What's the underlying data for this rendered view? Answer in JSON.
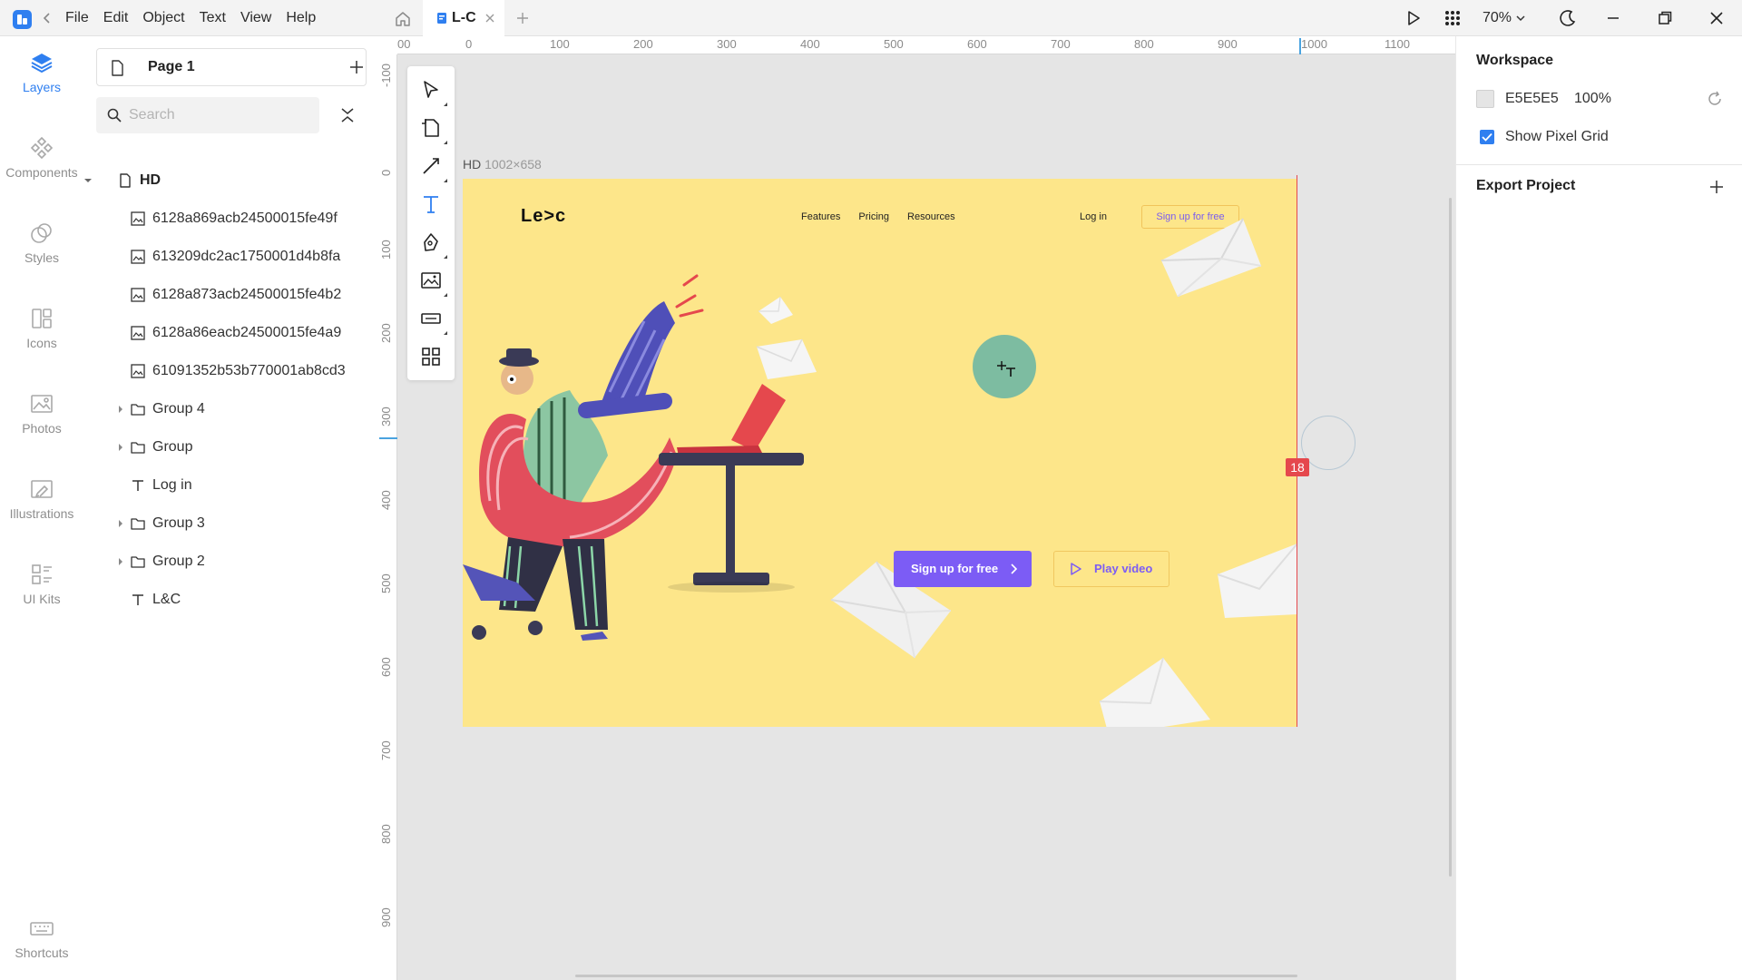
{
  "titlebar": {
    "menu": [
      "File",
      "Edit",
      "Object",
      "Text",
      "View",
      "Help"
    ],
    "tab_label": "L-C",
    "zoom": "70%"
  },
  "rail": {
    "items": [
      {
        "label": "Layers",
        "icon": "layers-icon",
        "active": true
      },
      {
        "label": "Components",
        "icon": "components-icon"
      },
      {
        "label": "Styles",
        "icon": "styles-icon"
      },
      {
        "label": "Icons",
        "icon": "icons-icon"
      },
      {
        "label": "Photos",
        "icon": "photos-icon"
      },
      {
        "label": "Illustrations",
        "icon": "illustrations-icon"
      },
      {
        "label": "UI Kits",
        "icon": "ui-kits-icon"
      }
    ],
    "shortcuts_label": "Shortcuts"
  },
  "layers": {
    "page_name": "Page 1",
    "search_placeholder": "Search",
    "tree": [
      {
        "label": "HD",
        "type": "frame",
        "depth": 0,
        "expandable": true,
        "expanded": true
      },
      {
        "label": "6128a869acb24500015fe49f",
        "type": "image",
        "depth": 1
      },
      {
        "label": "613209dc2ac1750001d4b8fa",
        "type": "image",
        "depth": 1
      },
      {
        "label": "6128a873acb24500015fe4b2",
        "type": "image",
        "depth": 1
      },
      {
        "label": "6128a86eacb24500015fe4a9",
        "type": "image",
        "depth": 1
      },
      {
        "label": "61091352b53b770001ab8cd3",
        "type": "image",
        "depth": 1
      },
      {
        "label": "Group 4",
        "type": "group",
        "depth": 1,
        "expandable": true
      },
      {
        "label": "Group",
        "type": "group",
        "depth": 1,
        "expandable": true
      },
      {
        "label": "Log in",
        "type": "text",
        "depth": 1
      },
      {
        "label": "Group 3",
        "type": "group",
        "depth": 1,
        "expandable": true
      },
      {
        "label": "Group 2",
        "type": "group",
        "depth": 1,
        "expandable": true
      },
      {
        "label": "L&C",
        "type": "text",
        "depth": 1
      }
    ]
  },
  "ruler": {
    "h_labels": [
      "00",
      "0",
      "100",
      "200",
      "300",
      "400",
      "500",
      "600",
      "700",
      "800",
      "900",
      "1000",
      "1100"
    ],
    "v_labels": [
      "-100",
      "0",
      "100",
      "200",
      "300",
      "400",
      "500",
      "600",
      "700",
      "800",
      "900"
    ]
  },
  "canvas": {
    "frame_name": "HD",
    "frame_size": "1002×658",
    "measure_value": "18",
    "site": {
      "logo": "Le>c",
      "nav": [
        "Features",
        "Pricing",
        "Resources"
      ],
      "login": "Log in",
      "signup_top": "Sign up for free",
      "cta_primary": "Sign up for free",
      "cta_secondary": "Play video"
    }
  },
  "props": {
    "workspace_title": "Workspace",
    "bg_color": "E5E5E5",
    "bg_opacity": "100%",
    "show_pixel_grid_label": "Show Pixel Grid",
    "show_pixel_grid": true,
    "export_title": "Export Project"
  },
  "colors": {
    "accent": "#2f7ff0",
    "frame_bg": "#fde68a",
    "cta": "#7c5cf5",
    "measure": "#e5484d"
  }
}
